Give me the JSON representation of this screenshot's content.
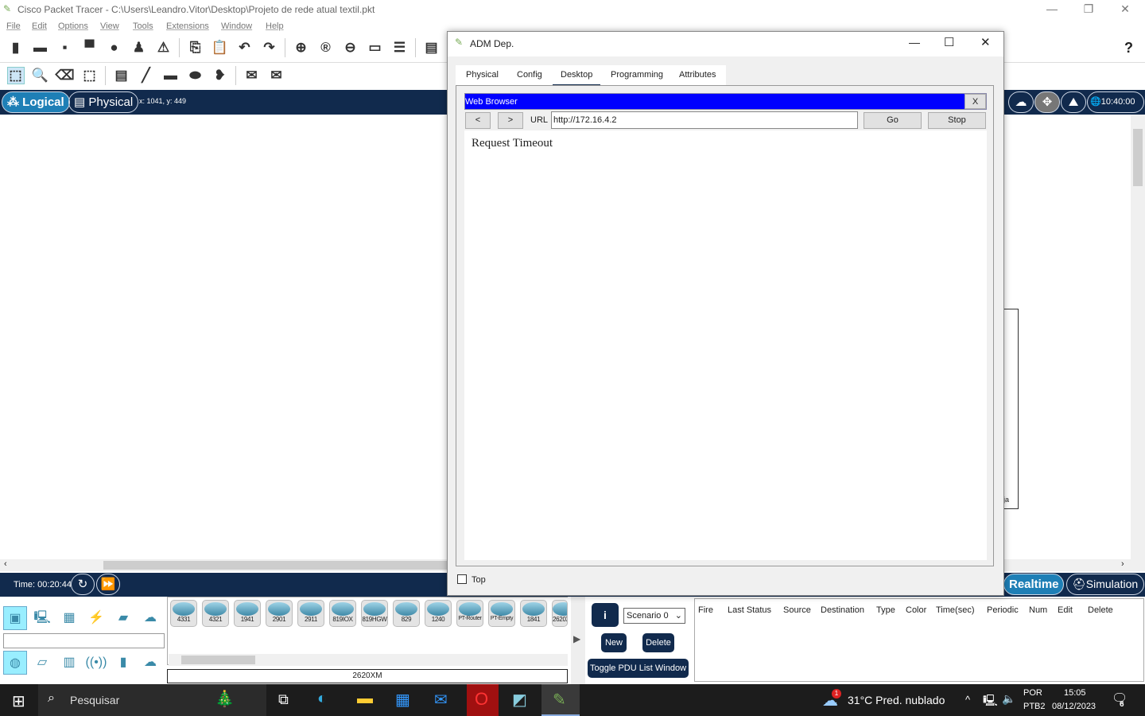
{
  "window": {
    "title": "Cisco Packet Tracer - C:\\Users\\Leandro.Vitor\\Desktop\\Projeto de rede atual textil.pkt",
    "minimize": "—",
    "restore": "❐",
    "close": "✕"
  },
  "menu": [
    "File",
    "Edit",
    "Options",
    "View",
    "Tools",
    "Extensions",
    "Window",
    "Help"
  ],
  "toolbar1": [
    "new-file",
    "open-folder",
    "save",
    "print",
    "info",
    "activity-wizard",
    "network-info",
    "sep",
    "copy",
    "paste",
    "undo",
    "redo",
    "sep",
    "zoom-in",
    "zoom-reset",
    "zoom-out",
    "drawing-palette",
    "custom-device",
    "sep",
    "viewport"
  ],
  "toolbar1_glyphs": [
    "▮",
    "▬",
    "▪",
    "▀",
    "●",
    "♟",
    "⚠",
    "",
    "⎘",
    "📋",
    "↶",
    "↷",
    "",
    "⊕",
    "®",
    "⊖",
    "▭",
    "☰",
    "",
    "▤"
  ],
  "toolbar2": [
    "select",
    "inspect",
    "delete",
    "resize",
    "sep",
    "note",
    "line",
    "rectangle",
    "ellipse",
    "freeform",
    "sep",
    "add-simple-pdu",
    "add-complex-pdu"
  ],
  "toolbar2_glyphs": [
    "⬚",
    "🔍",
    "⌫",
    "⬚",
    "",
    "▤",
    "╱",
    "▬",
    "⬬",
    "❥",
    "",
    "✉",
    "✉"
  ],
  "help": "?",
  "nav": {
    "logical": "Logical",
    "physical": "Physical",
    "coords": "x: 1041, y: 449",
    "clock": "10:40:00"
  },
  "canvas_label": "ja",
  "time": {
    "label": "Time: 00:20:44",
    "realtime": "Realtime",
    "simulation": "Simulation"
  },
  "device_models": [
    "4331",
    "4321",
    "1941",
    "2901",
    "2911",
    "819IOX",
    "819HGW",
    "829",
    "1240",
    "PT-Router",
    "PT-Empty",
    "1841",
    "2620XM"
  ],
  "selected_model": "2620XM",
  "scenario": {
    "select": "Scenario 0",
    "new": "New",
    "delete": "Delete",
    "toggle": "Toggle PDU List Window",
    "info": "i"
  },
  "pdu_columns": [
    "Fire",
    "Last Status",
    "Source",
    "Destination",
    "Type",
    "Color",
    "Time(sec)",
    "Periodic",
    "Num",
    "Edit",
    "Delete"
  ],
  "dialog": {
    "title": "ADM Dep.",
    "tabs": [
      "Physical",
      "Config",
      "Desktop",
      "Programming",
      "Attributes"
    ],
    "active_tab": "Desktop",
    "browser": {
      "title": "Web Browser",
      "close": "X",
      "back": "<",
      "forward": ">",
      "url_label": "URL",
      "url": "http://172.16.4.2",
      "go": "Go",
      "stop": "Stop",
      "content": "Request Timeout",
      "title_color": "#0000ff"
    },
    "top_label": "Top",
    "top_checked": false
  },
  "taskbar": {
    "search": "Pesquisar",
    "weather": "31°C  Pred. nublado",
    "weather_badge": "1",
    "lang1": "POR",
    "lang2": "PTB2",
    "time": "15:05",
    "date": "08/12/2023",
    "notifications": "6"
  }
}
